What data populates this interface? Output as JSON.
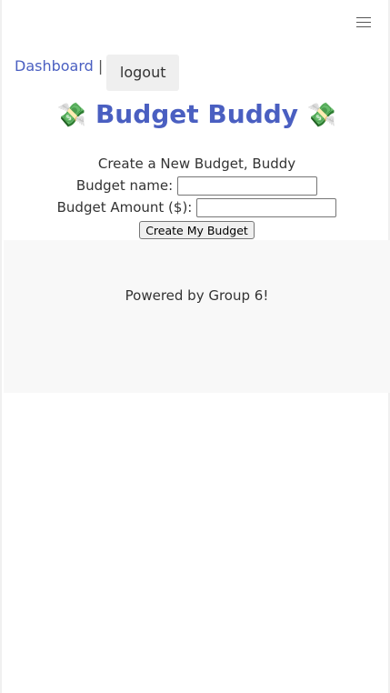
{
  "header": {
    "menu_icon": "hamburger-menu-icon"
  },
  "nav": {
    "dashboard_label": "Dashboard",
    "separator": "|",
    "logout_label": "logout"
  },
  "app": {
    "title": "Budget Buddy",
    "title_emoji_left": "💸",
    "title_emoji_right": "💸",
    "brand_color": "#4a5fc1"
  },
  "form": {
    "heading": "Create a New Budget, Buddy",
    "name_label": "Budget name:",
    "name_value": "",
    "amount_label": "Budget Amount ($):",
    "amount_value": "",
    "submit_label": "Create My Budget"
  },
  "footer": {
    "text": "Powered by Group 6!"
  }
}
